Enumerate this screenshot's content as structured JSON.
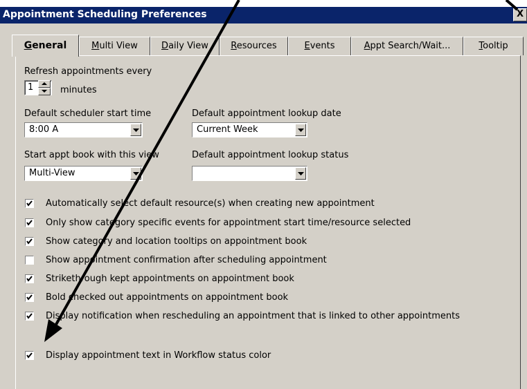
{
  "window": {
    "title": "Appointment Scheduling Preferences",
    "close_label": "X"
  },
  "tabs": [
    {
      "pre": "",
      "key": "G",
      "post": "eneral",
      "active": true
    },
    {
      "pre": "",
      "key": "M",
      "post": "ulti View",
      "active": false
    },
    {
      "pre": "",
      "key": "D",
      "post": "aily View",
      "active": false
    },
    {
      "pre": "",
      "key": "R",
      "post": "esources",
      "active": false
    },
    {
      "pre": "",
      "key": "E",
      "post": "vents",
      "active": false
    },
    {
      "pre": "",
      "key": "A",
      "post": "ppt Search/Wait...",
      "active": false
    },
    {
      "pre": "",
      "key": "T",
      "post": "ooltip",
      "active": false
    }
  ],
  "refresh": {
    "label": "Refresh appointments every",
    "value": "1",
    "unit": "minutes"
  },
  "start_time": {
    "label": "Default scheduler start time",
    "value": "8:00 A"
  },
  "lookup_date": {
    "label": "Default appointment lookup date",
    "value": "Current Week"
  },
  "start_view": {
    "label": "Start appt book with this view",
    "value": "Multi-View"
  },
  "lookup_status": {
    "label": "Default appointment lookup status",
    "value": ""
  },
  "options": [
    {
      "label": "Automatically select default resource(s) when creating new appointment",
      "checked": true
    },
    {
      "label": "Only show category specific events for appointment start time/resource selected",
      "checked": true
    },
    {
      "label": "Show category and location tooltips on appointment book",
      "checked": true
    },
    {
      "label": "Show appointment confirmation after scheduling appointment",
      "checked": false
    },
    {
      "label": "Strikethrough kept appointments on appointment book",
      "checked": true
    },
    {
      "label": "Bold checked out appointments on appointment book",
      "checked": true
    },
    {
      "label": "Display notification when rescheduling an appointment that is linked to other appointments",
      "checked": true
    },
    {
      "label": "Display appointment text in Workflow status color",
      "checked": true
    }
  ]
}
